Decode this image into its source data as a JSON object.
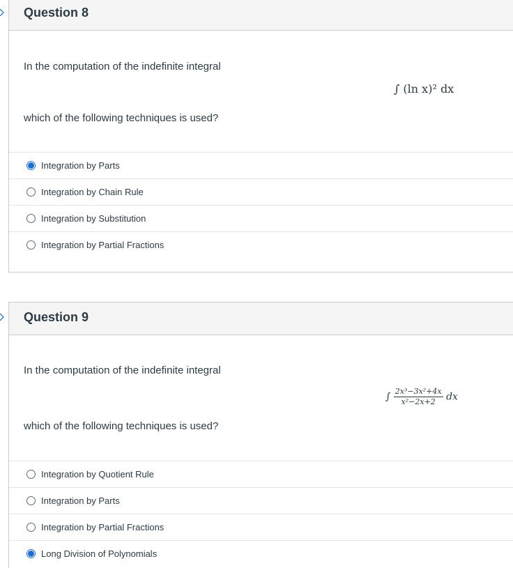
{
  "questions": [
    {
      "title": "Question 8",
      "prompt": "In the computation of the indefinite integral",
      "formula_text": "∫ (ln x)² dx",
      "followup": "which of the following techniques is used?",
      "answers": [
        {
          "label": "Integration by Parts",
          "selected": true
        },
        {
          "label": "Integration by Chain Rule",
          "selected": false
        },
        {
          "label": "Integration by Substitution",
          "selected": false
        },
        {
          "label": "Integration by Partial Fractions",
          "selected": false
        }
      ]
    },
    {
      "title": "Question 9",
      "prompt": "In the computation of the indefinite integral",
      "formula_numerator": "2x³−3x²+4x",
      "formula_denominator": "x²−2x+2",
      "followup": "which of the following techniques is used?",
      "answers": [
        {
          "label": "Integration by Quotient Rule",
          "selected": false
        },
        {
          "label": "Integration by Parts",
          "selected": false
        },
        {
          "label": "Integration by Partial Fractions",
          "selected": false
        },
        {
          "label": "Long Division of Polynomials",
          "selected": true
        }
      ]
    }
  ],
  "colors": {
    "accent": "#1c6dd0",
    "header_bg": "#f5f5f5",
    "border": "#c7cdd1",
    "text": "#2d3b45"
  }
}
